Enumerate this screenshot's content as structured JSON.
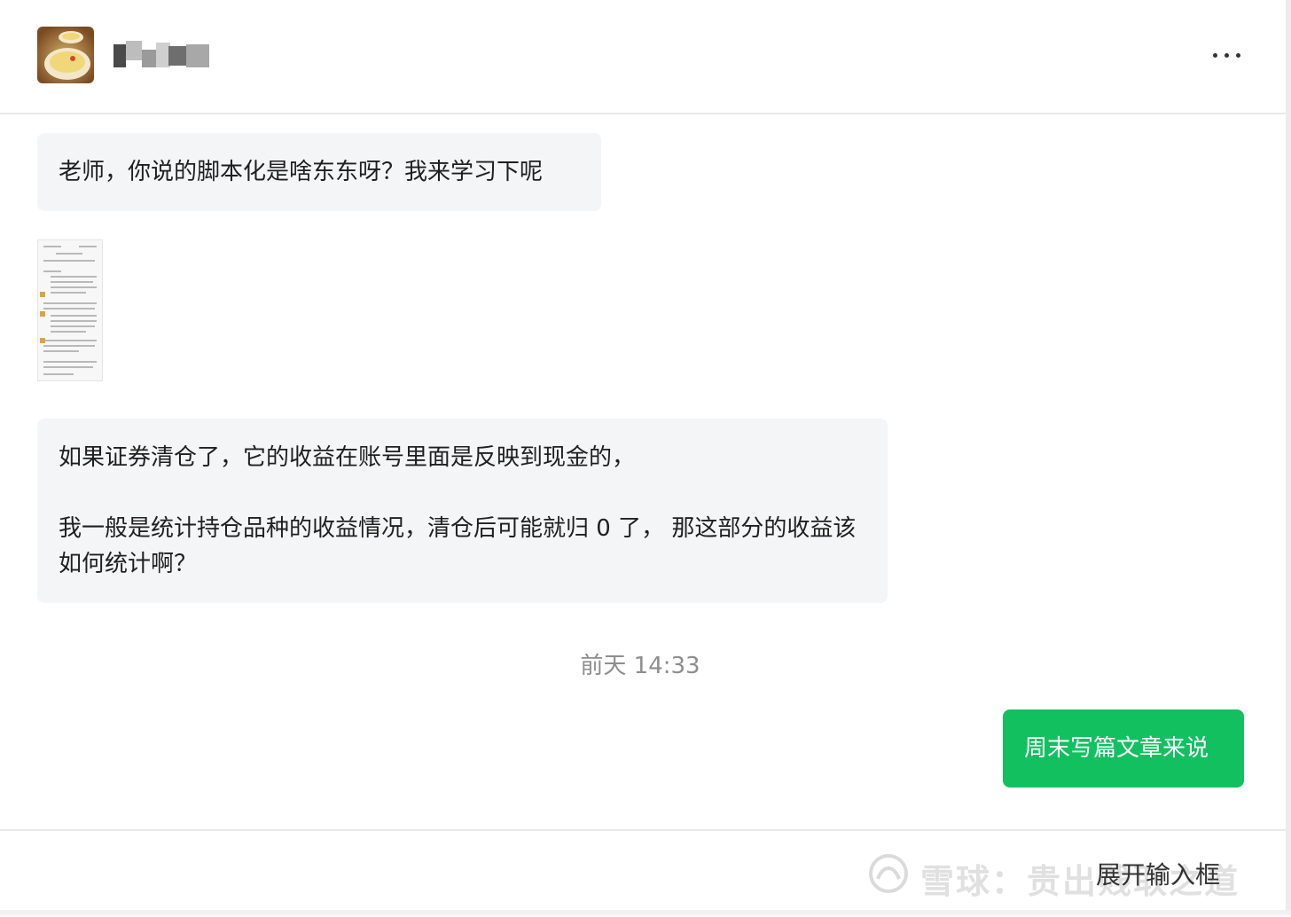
{
  "header": {
    "avatar": "avatar-photo",
    "contact_name_redacted": true,
    "more_icon": "more-horizontal-icon"
  },
  "messages": [
    {
      "side": "left",
      "text": "老师，你说的脚本化是啥东东呀？我来学习下呢"
    },
    {
      "side": "left",
      "type": "image",
      "icon": "screenshot-thumbnail"
    },
    {
      "side": "left",
      "lines": [
        "如果证券清仓了，它的收益在账号里面是反映到现金的，",
        "我一般是统计持仓品种的收益情况，清仓后可能就归 0 了， 那这部分的收益该如何统计啊？"
      ]
    }
  ],
  "timestamp": "前天 14:33",
  "reply": {
    "side": "right",
    "text": "周末写篇文章来说"
  },
  "footer": {
    "input_placeholder": "展开输入框",
    "watermark": "雪球：贵出贱取之道"
  },
  "colors": {
    "bubble_left": "#f4f5f7",
    "bubble_right": "#12c060",
    "timestamp": "#8e8e8e"
  }
}
